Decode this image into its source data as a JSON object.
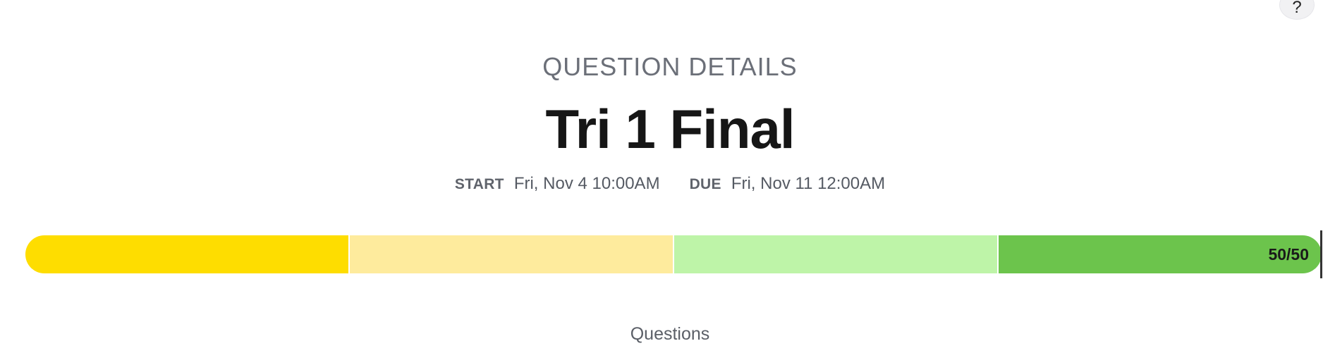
{
  "help": {
    "label": "?"
  },
  "header": {
    "eyebrow": "QUESTION DETAILS",
    "title": "Tri 1 Final"
  },
  "dates": {
    "start_label": "START",
    "start_value": "Fri, Nov 4 10:00AM",
    "due_label": "DUE",
    "due_value": "Fri, Nov 11 12:00AM"
  },
  "progress": {
    "count_text": "50/50",
    "completed": 50,
    "total": 50,
    "segment_colors": [
      "#fedd00",
      "#feeb9d",
      "#bef4a8",
      "#6cc44c"
    ]
  },
  "sections": {
    "questions_label": "Questions"
  }
}
